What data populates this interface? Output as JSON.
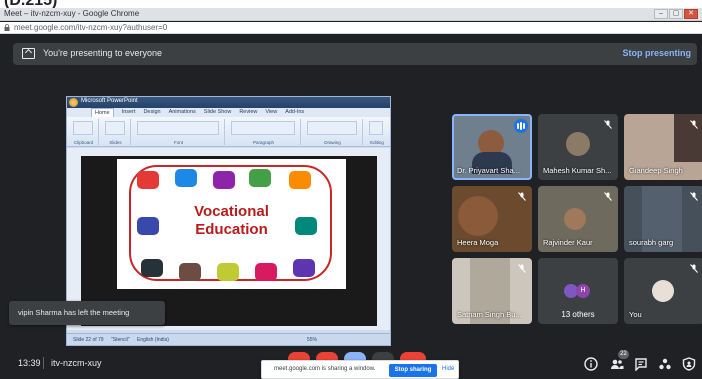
{
  "top_fragment": "(D.215)",
  "browser": {
    "window_title": "Meet – itv-nzcm-xuy - Google Chrome",
    "url": "meet.google.com/itv-nzcm-xuy?authuser=0",
    "window_buttons": [
      "–",
      "▢",
      "✕"
    ]
  },
  "banner": {
    "message": "You're presenting to everyone",
    "stop_label": "Stop presenting"
  },
  "presentation": {
    "app_title": "Microsoft PowerPoint",
    "tabs": [
      "Home",
      "Insert",
      "Design",
      "Animations",
      "Slide Show",
      "Review",
      "View",
      "Add-Ins"
    ],
    "groups": [
      "Clipboard",
      "Slides",
      "Font",
      "Paragraph",
      "Drawing",
      "Editing"
    ],
    "slide_text_line1": "Vocational",
    "slide_text_line2": "Education",
    "status_slide": "Slide 22 of 79",
    "status_theme": "\"Stencil\"",
    "status_lang": "English (India)",
    "zoom": "55%"
  },
  "toast": "vipin Sharma has left the meeting",
  "participants": [
    {
      "name": "Dr. Priyavart Sha...",
      "speaking": true
    },
    {
      "name": "Mahesh Kumar Sh...",
      "muted": true
    },
    {
      "name": "Giandeep Singh",
      "muted": true
    },
    {
      "name": "Heera Moga",
      "muted": true
    },
    {
      "name": "Rajvinder Kaur",
      "muted": true
    },
    {
      "name": "sourabh garg",
      "muted": true
    },
    {
      "name": "Satnam Singh Bu...",
      "muted": true
    },
    {
      "name": "13 others",
      "avatar_letter": "H"
    },
    {
      "name": "You",
      "muted": true
    }
  ],
  "bottom": {
    "time": "13:39",
    "meeting_code": "itv-nzcm-xuy",
    "share_message": "meet.google.com is sharing a window.",
    "stop_sharing": "Stop sharing",
    "hide": "Hide",
    "participants_count": "22"
  },
  "colors": {
    "meet_bg": "#202124",
    "tile_bg": "#3c4043",
    "accent_blue": "#8ab4f8",
    "google_blue": "#1a73e8",
    "slide_red": "#b71c1c"
  }
}
